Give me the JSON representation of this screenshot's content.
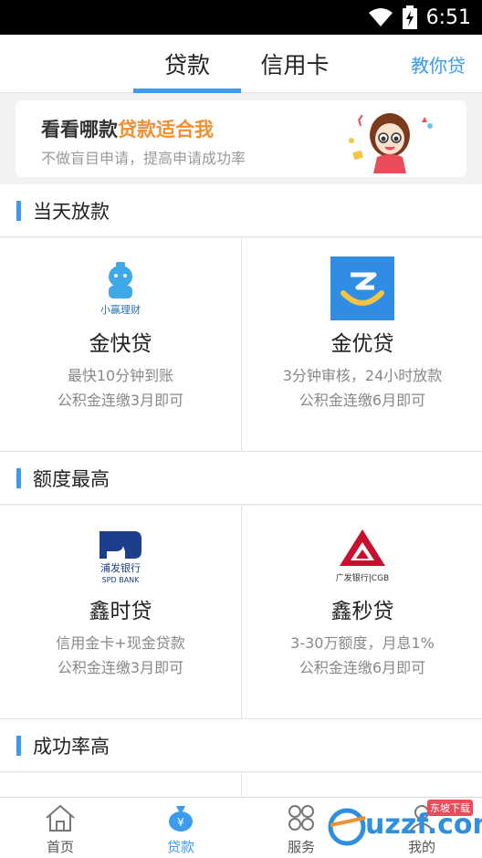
{
  "status_bar": {
    "time": "6:51"
  },
  "top_nav": {
    "tabs": [
      {
        "label": "贷款",
        "active": true
      },
      {
        "label": "信用卡",
        "active": false
      }
    ],
    "right_link": "教你贷"
  },
  "banner": {
    "title_prefix": "看看哪款",
    "title_highlight": "贷款适合我",
    "subtitle": "不做盲目申请，提高申请成功率"
  },
  "sections": [
    {
      "title": "当天放款",
      "items": [
        {
          "name": "金快贷",
          "logo_text": "小赢理财",
          "desc1": "最快10分钟到账",
          "desc2": "公积金连缴3月即可"
        },
        {
          "name": "金优贷",
          "logo_text": "",
          "desc1": "3分钟审核，24小时放款",
          "desc2": "公积金连缴6月即可"
        }
      ]
    },
    {
      "title": "额度最高",
      "items": [
        {
          "name": "鑫时贷",
          "logo_text": "浦发银行",
          "logo_sub": "SPD BANK",
          "desc1": "信用金卡+现金贷款",
          "desc2": "公积金连缴3月即可"
        },
        {
          "name": "鑫秒贷",
          "logo_text": "广发银行|CGB",
          "desc1": "3-30万额度，月息1%",
          "desc2": "公积金连缴6月即可"
        }
      ]
    },
    {
      "title": "成功率高",
      "items": []
    }
  ],
  "tab_bar": [
    {
      "label": "首页",
      "icon": "home-icon",
      "active": false
    },
    {
      "label": "贷款",
      "icon": "moneybag-icon",
      "active": true
    },
    {
      "label": "服务",
      "icon": "grid-icon",
      "active": false
    },
    {
      "label": "我的",
      "icon": "person-icon",
      "active": false
    }
  ],
  "watermark": {
    "text": "uzzf.com",
    "badge": "东坡下载"
  },
  "colors": {
    "accent": "#3a9bef",
    "highlight": "#f29030"
  }
}
